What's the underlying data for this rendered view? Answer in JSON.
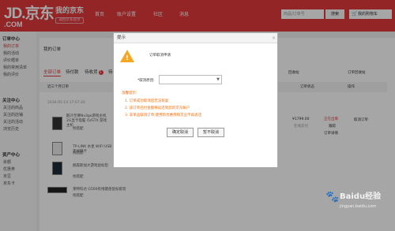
{
  "header": {
    "logo_text": "JD.",
    "logo_cn": "京东",
    "logo_com": ".COM",
    "myjd_title": "我的京东",
    "myjd_sub": "返回京东首页",
    "nav": [
      "首页",
      "账户设置",
      "社区",
      "消息"
    ],
    "search_placeholder": "商品/订单号",
    "search_button": "搜索",
    "cart_label": "我的购物车"
  },
  "sidebar": {
    "sections": [
      {
        "title": "订单中心",
        "items": [
          "我的订单",
          "我的活动",
          "评价晒单",
          "我的常用清单",
          "我的评价"
        ]
      },
      {
        "title": "关注中心",
        "items": [
          "关注的商品",
          "关注的店铺",
          "关注的活动",
          "浏览历史"
        ]
      },
      {
        "title": "资产中心",
        "items": [
          "余额",
          "优惠券",
          "京豆",
          "京东卡"
        ]
      }
    ]
  },
  "main": {
    "title": "我的订单",
    "tabs": [
      {
        "label": "全部订单",
        "badge": ""
      },
      {
        "label": "待付款",
        "badge": ""
      },
      {
        "label": "待收货",
        "badge": "1"
      },
      {
        "label": "待评价",
        "badge": ""
      }
    ],
    "right_links": [
      "回收站",
      "订单回收站"
    ],
    "filter_label": "近三个月订单",
    "filter_right_label": "订单状态",
    "search_button": "搜索",
    "columns": [
      "订单详情",
      "收货人",
      "金额",
      "全部状态",
      "操作"
    ],
    "order_date": "2016-05-14 17:07:20",
    "order_number_label": "订单号: 176",
    "products": [
      {
        "name": "酷冷至尊Nv3ge游戏主机 2G显卡电脑 i5/GTX 游戏主机",
        "tag": "找搭配"
      },
      {
        "name": "TP-LINK 水星 WIFI USB无线网卡",
        "tag": "找搭配"
      },
      {
        "name": "赫森斯加大游戏鼠标垫",
        "tag": "找搭配"
      },
      {
        "name": "莱特科达 G500有线键盘鼠标套装",
        "tag": "找搭配"
      }
    ],
    "amount": "¥1799.00",
    "payment": "在线支付",
    "status": "正在出库",
    "action_status": "跟踪",
    "detail": "订单详情",
    "cancel": "取消订单",
    "buy_again": "再次购买"
  },
  "dialog": {
    "title": "提示",
    "message": "订单取消申请",
    "reason_label": "*取消原因:",
    "reason_value": "",
    "tips_title": "温馨提示:",
    "tips": [
      "1. 订单成功取消后无法恢复",
      "2. 该订单已付金额将返还到您的京东账户",
      "3. 非单品取消订单,使用的优惠券和京豆不再退还"
    ],
    "confirm_label": "确定取消",
    "cancel_label": "暂不取消"
  },
  "watermark": {
    "text": "Baidu经验",
    "sub": "jingyan.baidu.com"
  },
  "colors": {
    "brand": "#e4393c",
    "warn": "#f5a623",
    "tips": "#ff6a00"
  }
}
